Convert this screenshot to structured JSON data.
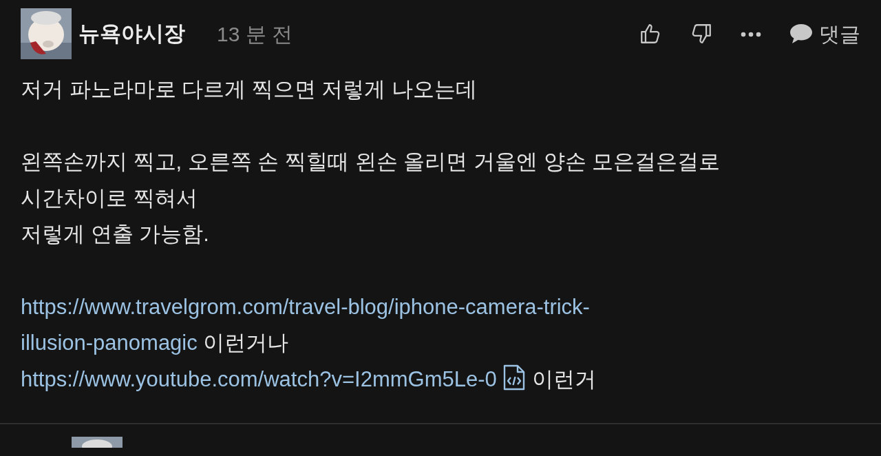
{
  "comment": {
    "author": "뉴욕야시장",
    "time": "13 분 전",
    "reply_label": "댓글",
    "paragraphs": [
      {
        "lines": [
          {
            "segments": [
              {
                "kind": "text",
                "text": "저거 파노라마로 다르게 찍으면 저렇게 나오는데"
              }
            ]
          }
        ]
      },
      {
        "lines": [
          {
            "segments": [
              {
                "kind": "text",
                "text": "왼쪽손까지 찍고, 오른쪽 손 찍힐때 왼손 올리면 거울엔 양손 모은걸은걸로"
              }
            ]
          },
          {
            "segments": [
              {
                "kind": "text",
                "text": "시간차이로 찍혀서"
              }
            ]
          },
          {
            "segments": [
              {
                "kind": "text",
                "text": "저렇게 연출 가능함."
              }
            ]
          }
        ]
      },
      {
        "lines": [
          {
            "segments": [
              {
                "kind": "link",
                "text": "https://www.travelgrom.com/travel-blog/iphone-camera-trick-"
              }
            ]
          },
          {
            "segments": [
              {
                "kind": "link",
                "text": "illusion-panomagic"
              },
              {
                "kind": "text",
                "text": "이런거나"
              }
            ]
          },
          {
            "segments": [
              {
                "kind": "link",
                "text": "https://www.youtube.com/watch?v=I2mmGm5Le-0"
              },
              {
                "kind": "embed"
              },
              {
                "kind": "text",
                "text": "이런거"
              }
            ]
          }
        ]
      }
    ]
  }
}
